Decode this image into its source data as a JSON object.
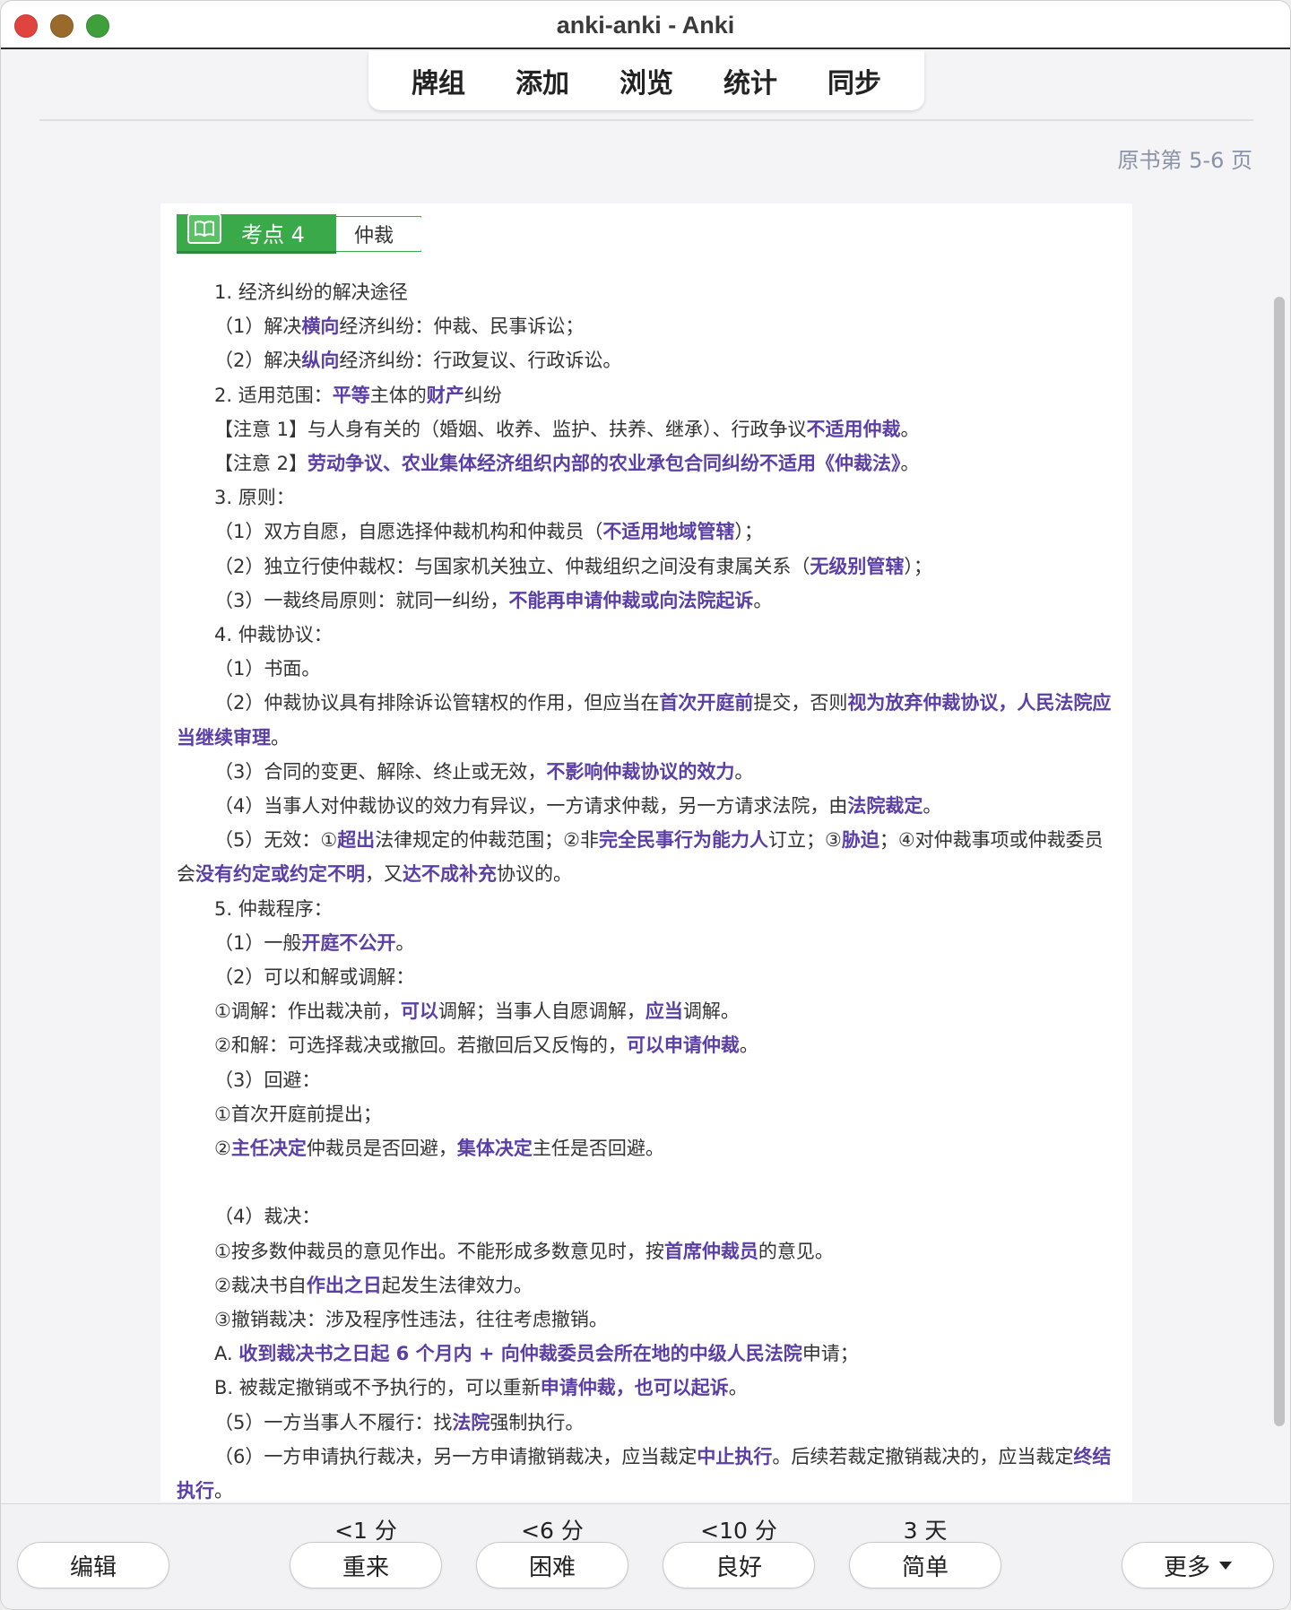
{
  "window": {
    "title": "anki-anki - Anki"
  },
  "toolbar": {
    "items": [
      "牌组",
      "添加",
      "浏览",
      "统计",
      "同步"
    ]
  },
  "page_ref": "原书第 5-6 页",
  "card": {
    "badge_label": "考点 4",
    "badge_topic": "仲裁",
    "lines": [
      [
        {
          "t": "1. 经济纠纷的解决途径"
        }
      ],
      [
        {
          "t": "（1）解决"
        },
        {
          "t": "横向",
          "h": true
        },
        {
          "t": "经济纠纷：仲裁、民事诉讼；"
        }
      ],
      [
        {
          "t": "（2）解决"
        },
        {
          "t": "纵向",
          "h": true
        },
        {
          "t": "经济纠纷：行政复议、行政诉讼。"
        }
      ],
      [
        {
          "t": "2. 适用范围："
        },
        {
          "t": "平等",
          "h": true
        },
        {
          "t": "主体的"
        },
        {
          "t": "财产",
          "h": true
        },
        {
          "t": "纠纷"
        }
      ],
      [
        {
          "t": "【注意 1】与人身有关的（婚姻、收养、监护、扶养、继承）、行政争议"
        },
        {
          "t": "不适用仲裁",
          "h": true
        },
        {
          "t": "。"
        }
      ],
      [
        {
          "t": "【注意 2】"
        },
        {
          "t": "劳动争议、农业集体经济组织内部的农业承包合同纠纷不适用《仲裁法》",
          "h": true
        },
        {
          "t": "。"
        }
      ],
      [
        {
          "t": "3. 原则："
        }
      ],
      [
        {
          "t": "（1）双方自愿，自愿选择仲裁机构和仲裁员（"
        },
        {
          "t": "不适用地域管辖",
          "h": true
        },
        {
          "t": "）；"
        }
      ],
      [
        {
          "t": "（2）独立行使仲裁权：与国家机关独立、仲裁组织之间没有隶属关系（"
        },
        {
          "t": "无级别管辖",
          "h": true
        },
        {
          "t": "）；"
        }
      ],
      [
        {
          "t": "（3）一裁终局原则：就同一纠纷，"
        },
        {
          "t": "不能再申请仲裁或向法院起诉",
          "h": true
        },
        {
          "t": "。"
        }
      ],
      [
        {
          "t": "4. 仲裁协议："
        }
      ],
      [
        {
          "t": "（1）书面。"
        }
      ],
      [
        {
          "t": "（2）仲裁协议具有排除诉讼管辖权的作用，但应当在"
        },
        {
          "t": "首次开庭前",
          "h": true
        },
        {
          "t": "提交，否则"
        },
        {
          "t": "视为放弃仲裁协议，人民法院应当继续审理",
          "h": true
        },
        {
          "t": "。"
        }
      ],
      [
        {
          "t": "（3）合同的变更、解除、终止或无效，"
        },
        {
          "t": "不影响仲裁协议的效力",
          "h": true
        },
        {
          "t": "。"
        }
      ],
      [
        {
          "t": "（4）当事人对仲裁协议的效力有异议，一方请求仲裁，另一方请求法院，由"
        },
        {
          "t": "法院裁定",
          "h": true
        },
        {
          "t": "。"
        }
      ],
      [
        {
          "t": "（5）无效：①"
        },
        {
          "t": "超出",
          "h": true
        },
        {
          "t": "法律规定的仲裁范围；②非"
        },
        {
          "t": "完全民事行为能力人",
          "h": true
        },
        {
          "t": "订立；③"
        },
        {
          "t": "胁迫",
          "h": true
        },
        {
          "t": "；④对仲裁事项或仲裁委员会"
        },
        {
          "t": "没有约定或约定不明",
          "h": true
        },
        {
          "t": "，又"
        },
        {
          "t": "达不成补充",
          "h": true
        },
        {
          "t": "协议的。"
        }
      ],
      [
        {
          "t": "5. 仲裁程序："
        }
      ],
      [
        {
          "t": "（1）一般"
        },
        {
          "t": "开庭不公开",
          "h": true
        },
        {
          "t": "。"
        }
      ],
      [
        {
          "t": "（2）可以和解或调解："
        }
      ],
      [
        {
          "t": "①调解：作出裁决前，"
        },
        {
          "t": "可以",
          "h": true
        },
        {
          "t": "调解；当事人自愿调解，"
        },
        {
          "t": "应当",
          "h": true
        },
        {
          "t": "调解。"
        }
      ],
      [
        {
          "t": "②和解：可选择裁决或撤回。若撤回后又反悔的，"
        },
        {
          "t": "可以申请仲裁",
          "h": true
        },
        {
          "t": "。"
        }
      ],
      [
        {
          "t": "（3）回避："
        }
      ],
      [
        {
          "t": "①首次开庭前提出；"
        }
      ],
      [
        {
          "t": "②"
        },
        {
          "t": "主任决定",
          "h": true
        },
        {
          "t": "仲裁员是否回避，"
        },
        {
          "t": "集体决定",
          "h": true
        },
        {
          "t": "主任是否回避。"
        }
      ],
      [],
      [
        {
          "t": "（4）裁决："
        }
      ],
      [
        {
          "t": "①按多数仲裁员的意见作出。不能形成多数意见时，按"
        },
        {
          "t": "首席仲裁员",
          "h": true
        },
        {
          "t": "的意见。"
        }
      ],
      [
        {
          "t": "②裁决书自"
        },
        {
          "t": "作出之日",
          "h": true
        },
        {
          "t": "起发生法律效力。"
        }
      ],
      [
        {
          "t": "③撤销裁决：涉及程序性违法，往往考虑撤销。"
        }
      ],
      [
        {
          "t": "A. "
        },
        {
          "t": "收到裁决书之日起 6 个月内 + 向仲裁委员会所在地的中级人民法院",
          "h": true
        },
        {
          "t": "申请；"
        }
      ],
      [
        {
          "t": "B. 被裁定撤销或不予执行的，可以重新"
        },
        {
          "t": "申请仲裁，也可以起诉",
          "h": true
        },
        {
          "t": "。"
        }
      ],
      [
        {
          "t": "（5）一方当事人不履行：找"
        },
        {
          "t": "法院",
          "h": true
        },
        {
          "t": "强制执行。"
        }
      ],
      [
        {
          "t": "（6）一方申请执行裁决，另一方申请撤销裁决，应当裁定"
        },
        {
          "t": "中止执行",
          "h": true
        },
        {
          "t": "。后续若裁定撤销裁决的，应当裁定"
        },
        {
          "t": "终结执行",
          "h": true
        },
        {
          "t": "。"
        }
      ]
    ]
  },
  "answer_bar": {
    "edit_label": "编辑",
    "more_label": "更多",
    "buttons": [
      {
        "label": "重来",
        "interval": "<1 分"
      },
      {
        "label": "困难",
        "interval": "<6 分"
      },
      {
        "label": "良好",
        "interval": "<10 分"
      },
      {
        "label": "简单",
        "interval": "3 天"
      }
    ]
  },
  "colors": {
    "highlight": "#5b3fa6",
    "badge_green": "#3aa94a",
    "page_ref": "#8a93a5"
  },
  "icons": {
    "badge": "open-book-icon",
    "more": "caret-down-icon"
  }
}
